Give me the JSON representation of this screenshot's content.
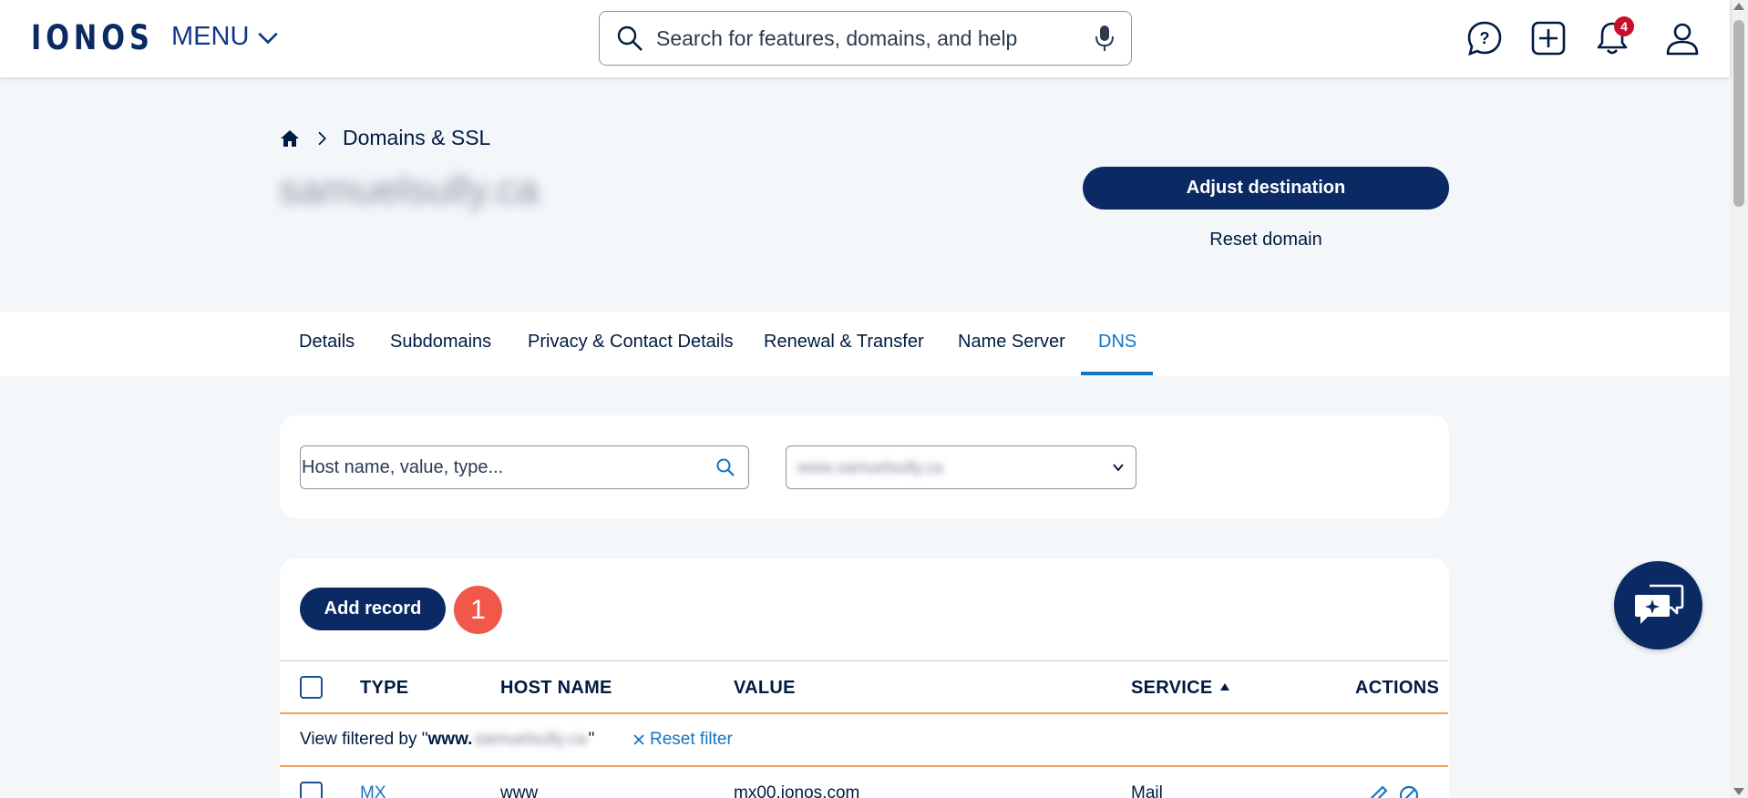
{
  "header": {
    "logo": "IONOS",
    "menu_label": "MENU",
    "search_placeholder": "Search for features, domains, and help",
    "notification_count": "4"
  },
  "breadcrumb": {
    "section": "Domains & SSL"
  },
  "domain": {
    "name": "samuelsully.ca",
    "adjust_label": "Adjust destination",
    "reset_label": "Reset domain"
  },
  "tabs": [
    {
      "label": "Details"
    },
    {
      "label": "Subdomains"
    },
    {
      "label": "Privacy & Contact Details"
    },
    {
      "label": "Renewal & Transfer"
    },
    {
      "label": "Name Server"
    },
    {
      "label": "DNS"
    }
  ],
  "active_tab": "DNS",
  "filters": {
    "search_placeholder": "Host name, value, type...",
    "select_value": "www.samuelsully.ca"
  },
  "records": {
    "add_label": "Add record",
    "step_number": "1",
    "columns": {
      "type": "TYPE",
      "host": "HOST NAME",
      "value": "VALUE",
      "service": "SERVICE",
      "actions": "ACTIONS"
    },
    "filter_prefix": "View filtered by \"",
    "filter_bold": "www.",
    "filter_domain": "samuelsully.ca",
    "filter_suffix": "\"",
    "reset_filter_label": "Reset filter",
    "rows": [
      {
        "type": "MX",
        "host": "www",
        "value": "mx00.ionos.com",
        "service": "Mail"
      }
    ]
  },
  "colors": {
    "brand": "#0b2a63",
    "link": "#1474c4",
    "badge": "#c8102e",
    "step_badge": "#f0584a",
    "filter_border": "#f0a05a"
  }
}
